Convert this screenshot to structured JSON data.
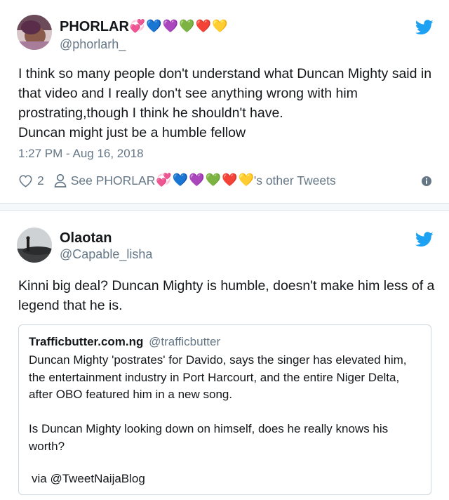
{
  "tweets": [
    {
      "display_name": "PHORLAR",
      "name_emojis": [
        "💞",
        "💙",
        "💜",
        "💚",
        "❤️",
        "💛"
      ],
      "handle": "@phorlarh_",
      "text_lines": [
        "I think so many people don't understand what Duncan Mighty said in that video and I  really don't see anything wrong with him prostrating,though I think he shouldn't have.",
        "Duncan might just be a humble fellow"
      ],
      "timestamp": "1:27 PM - Aug 16, 2018",
      "like_count": "2",
      "see_prefix": "See PHORLAR",
      "see_suffix": "'s other Tweets"
    },
    {
      "display_name": "Olaotan",
      "handle": "@Capable_lisha",
      "text": "Kinni big deal? Duncan Mighty is humble, doesn't make him less of a legend that he is.",
      "quote": {
        "name": "Trafficbutter.com.ng",
        "handle": "@trafficbutter",
        "paragraph1": "Duncan Mighty 'postrates' for Davido, says the singer has elevated him, the entertainment industry in Port Harcourt, and the entire Niger Delta, after OBO featured him in a new song.",
        "paragraph2": "Is Duncan Mighty looking down on himself, does he really knows his worth?",
        "via": "via @TweetNaijaBlog"
      }
    }
  ],
  "colors": {
    "twitter_blue": "#1da1f2",
    "muted": "#657786",
    "text": "#14171a",
    "border": "#e1e8ed"
  },
  "icons": [
    "twitter-bird-icon",
    "heart-icon",
    "person-icon",
    "info-icon"
  ]
}
